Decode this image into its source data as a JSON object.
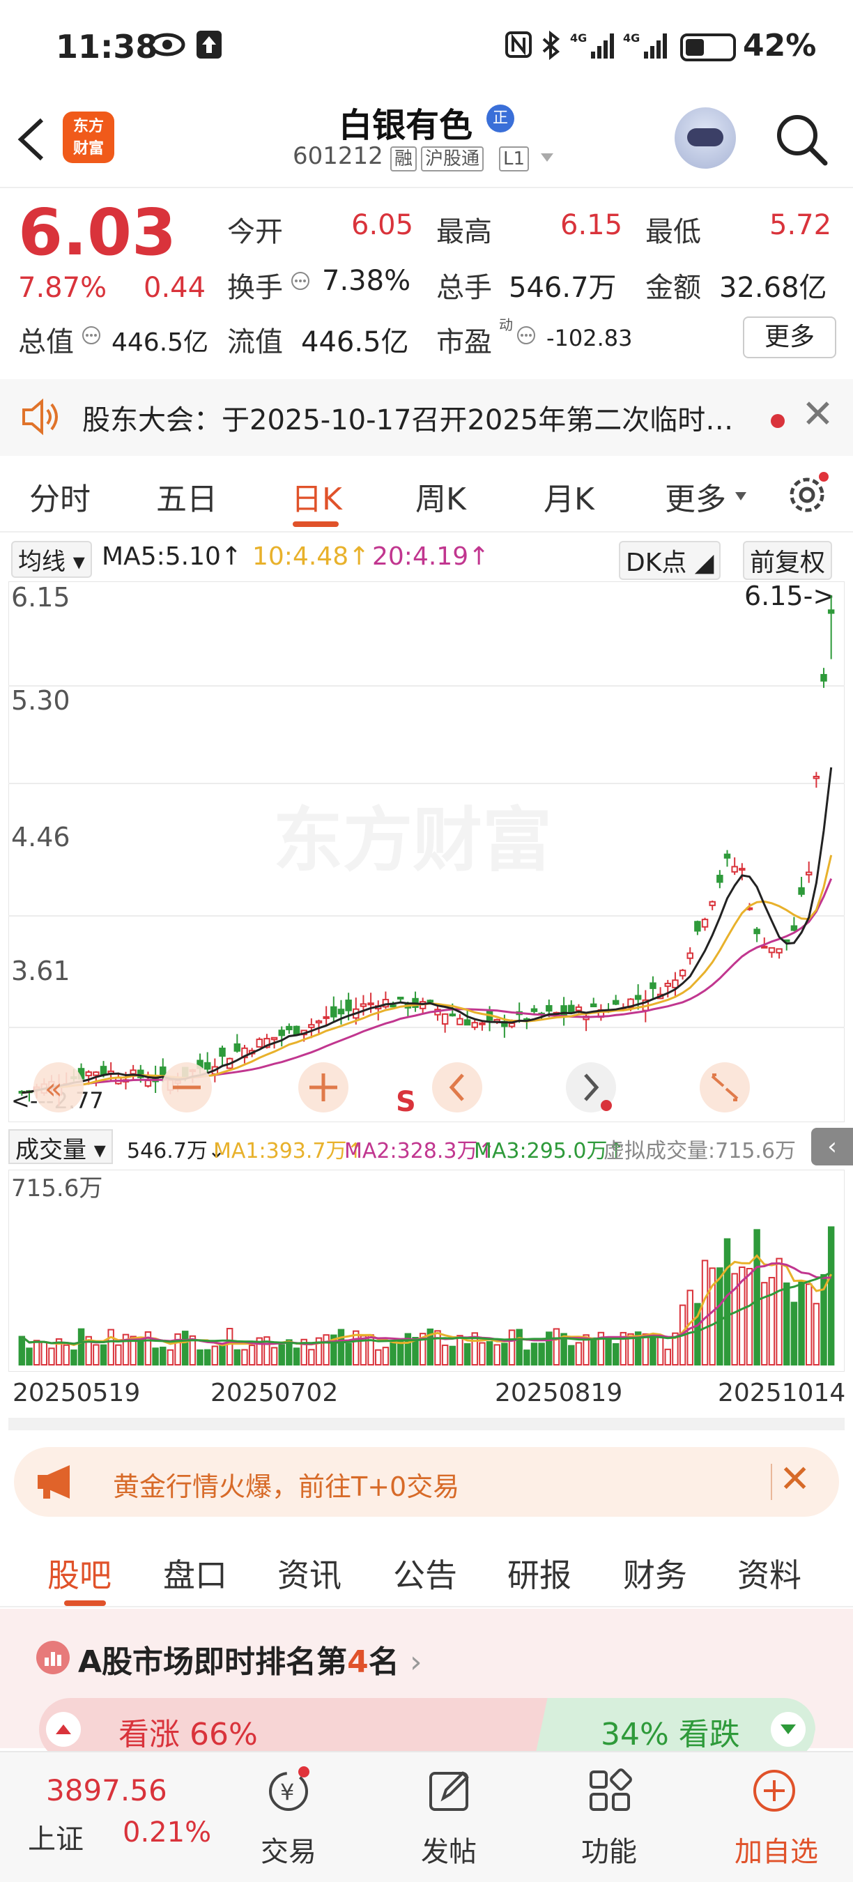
{
  "status": {
    "time": "11:38",
    "battery": "42%"
  },
  "header": {
    "logo_line1": "东方",
    "logo_line2": "财富",
    "name": "白银有色",
    "badge": "正",
    "code": "601212",
    "tags": [
      "融",
      "沪股通",
      "L1"
    ]
  },
  "quote": {
    "price": "6.03",
    "pct": "7.87%",
    "change": "0.44",
    "rows": [
      [
        {
          "label": "今开",
          "value": "6.05"
        },
        {
          "label": "最高",
          "value": "6.15"
        },
        {
          "label": "最低",
          "value": "5.72"
        }
      ],
      [
        {
          "label": "换手",
          "value": "7.38%"
        },
        {
          "label": "总手",
          "value": "546.7万"
        },
        {
          "label": "金额",
          "value": "32.68亿"
        }
      ]
    ],
    "row3": {
      "total_label": "总值",
      "total_value": "446.5亿",
      "float_label": "流值",
      "float_value": "446.5亿",
      "pe_label": "市盈",
      "pe_sup": "动",
      "pe_value": "-102.83"
    },
    "more_label": "更多"
  },
  "notice": {
    "text": "股东大会：于2025-10-17召开2025年第二次临时…"
  },
  "kline_tabs": [
    "分时",
    "五日",
    "日K",
    "周K",
    "月K",
    "更多"
  ],
  "ma_bar": {
    "selector": "均线",
    "ma5": "MA5:5.10",
    "ma10": "10:4.48",
    "ma20": "20:4.19",
    "dk": "DK点",
    "adj": "前复权",
    "ma5_color": "#222222",
    "ma10_color": "#e8b12b",
    "ma20_color": "#c1368f"
  },
  "chart": {
    "y_labels": [
      "6.15",
      "5.30",
      "4.46",
      "3.61"
    ],
    "max_label": "6.15->",
    "min_label": "<---2.77",
    "watermark": "东方财富",
    "s_marker": "S"
  },
  "volume": {
    "selector": "成交量",
    "current": "546.7万",
    "ma1": "MA1:393.7万",
    "ma2": "MA2:328.3万",
    "ma3": "MA3:295.0万",
    "virtual": "虚拟成交量:715.6万",
    "max_label": "715.6万"
  },
  "dates": [
    "20250519",
    "20250702",
    "20250819",
    "20251014"
  ],
  "promo": {
    "text": "黄金行情火爆，前往T+0交易"
  },
  "bottom_tabs": [
    "股吧",
    "盘口",
    "资讯",
    "公告",
    "研报",
    "财务",
    "资料"
  ],
  "ranking": {
    "prefix": "A股市场即时排名第",
    "rank": "4",
    "suffix": "名",
    "up": "看涨 66%",
    "down": "34% 看跌"
  },
  "bottom_nav": {
    "index_value": "3897.56",
    "index_name": "上证",
    "index_pct": "0.21%",
    "items": [
      "交易",
      "发帖",
      "功能",
      "加自选"
    ]
  },
  "chart_data": {
    "type": "candlestick",
    "title": "",
    "series": [
      {
        "name": "MA5",
        "value": 5.1
      },
      {
        "name": "MA10",
        "value": 4.48
      },
      {
        "name": "MA20",
        "value": 4.19
      }
    ],
    "y_ticks": [
      6.15,
      5.3,
      4.46,
      3.61
    ],
    "y_high": 6.15,
    "y_low": 2.77,
    "last": {
      "open": 6.05,
      "high": 6.15,
      "low": 5.72,
      "close": 6.03
    },
    "x_ticks": [
      "20250519",
      "20250702",
      "20250819",
      "20251014"
    ],
    "volume": {
      "current": "546.7万",
      "max": "715.6万",
      "MA1": "393.7万",
      "MA2": "328.3万",
      "MA3": "295.0万"
    }
  }
}
